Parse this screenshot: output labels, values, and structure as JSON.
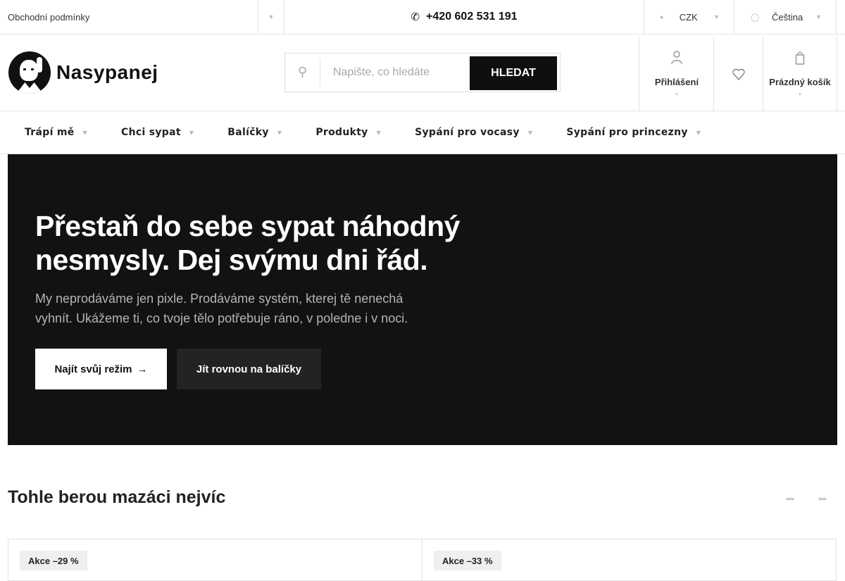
{
  "topbar": {
    "terms_link": "Obchodní podmínky",
    "phone": "+420 602 531 191",
    "currency": "CZK",
    "language": "Čeština"
  },
  "header": {
    "logo_text": "Nasypanej",
    "search_placeholder": "Napište, co hledáte",
    "search_button": "HLEDAT",
    "login_label": "Přihlášení",
    "cart_label": "Prázdný košík"
  },
  "nav": {
    "items": [
      {
        "label": "Trápí mě"
      },
      {
        "label": "Chci sypat"
      },
      {
        "label": "Balíčky"
      },
      {
        "label": "Produkty"
      },
      {
        "label": "Sypání pro vocasy"
      },
      {
        "label": "Sypání pro princezny"
      }
    ]
  },
  "hero": {
    "title_line1": "Přestaň do sebe sypat náhodný",
    "title_line2": "nesmysly. Dej svýmu dni řád.",
    "subtitle_line1": "My neprodáváme jen pixle. Prodáváme systém, kterej tě nenechá",
    "subtitle_line2": "vyhnít. Ukážeme ti, co tvoje tělo potřebuje ráno, v poledne i v noci.",
    "primary_button": "Najít svůj režim",
    "primary_arrow": "→",
    "secondary_button": "Jít rovnou na balíčky"
  },
  "bestsellers": {
    "title": "Tohle berou mazáci nejvíc",
    "cards": [
      {
        "badge": "Akce –29 %"
      },
      {
        "badge": "Akce –33 %"
      }
    ]
  },
  "colors": {
    "hero_bg": "#121213",
    "accent_dark": "#0f0f0f",
    "border": "#e3e3e3"
  }
}
